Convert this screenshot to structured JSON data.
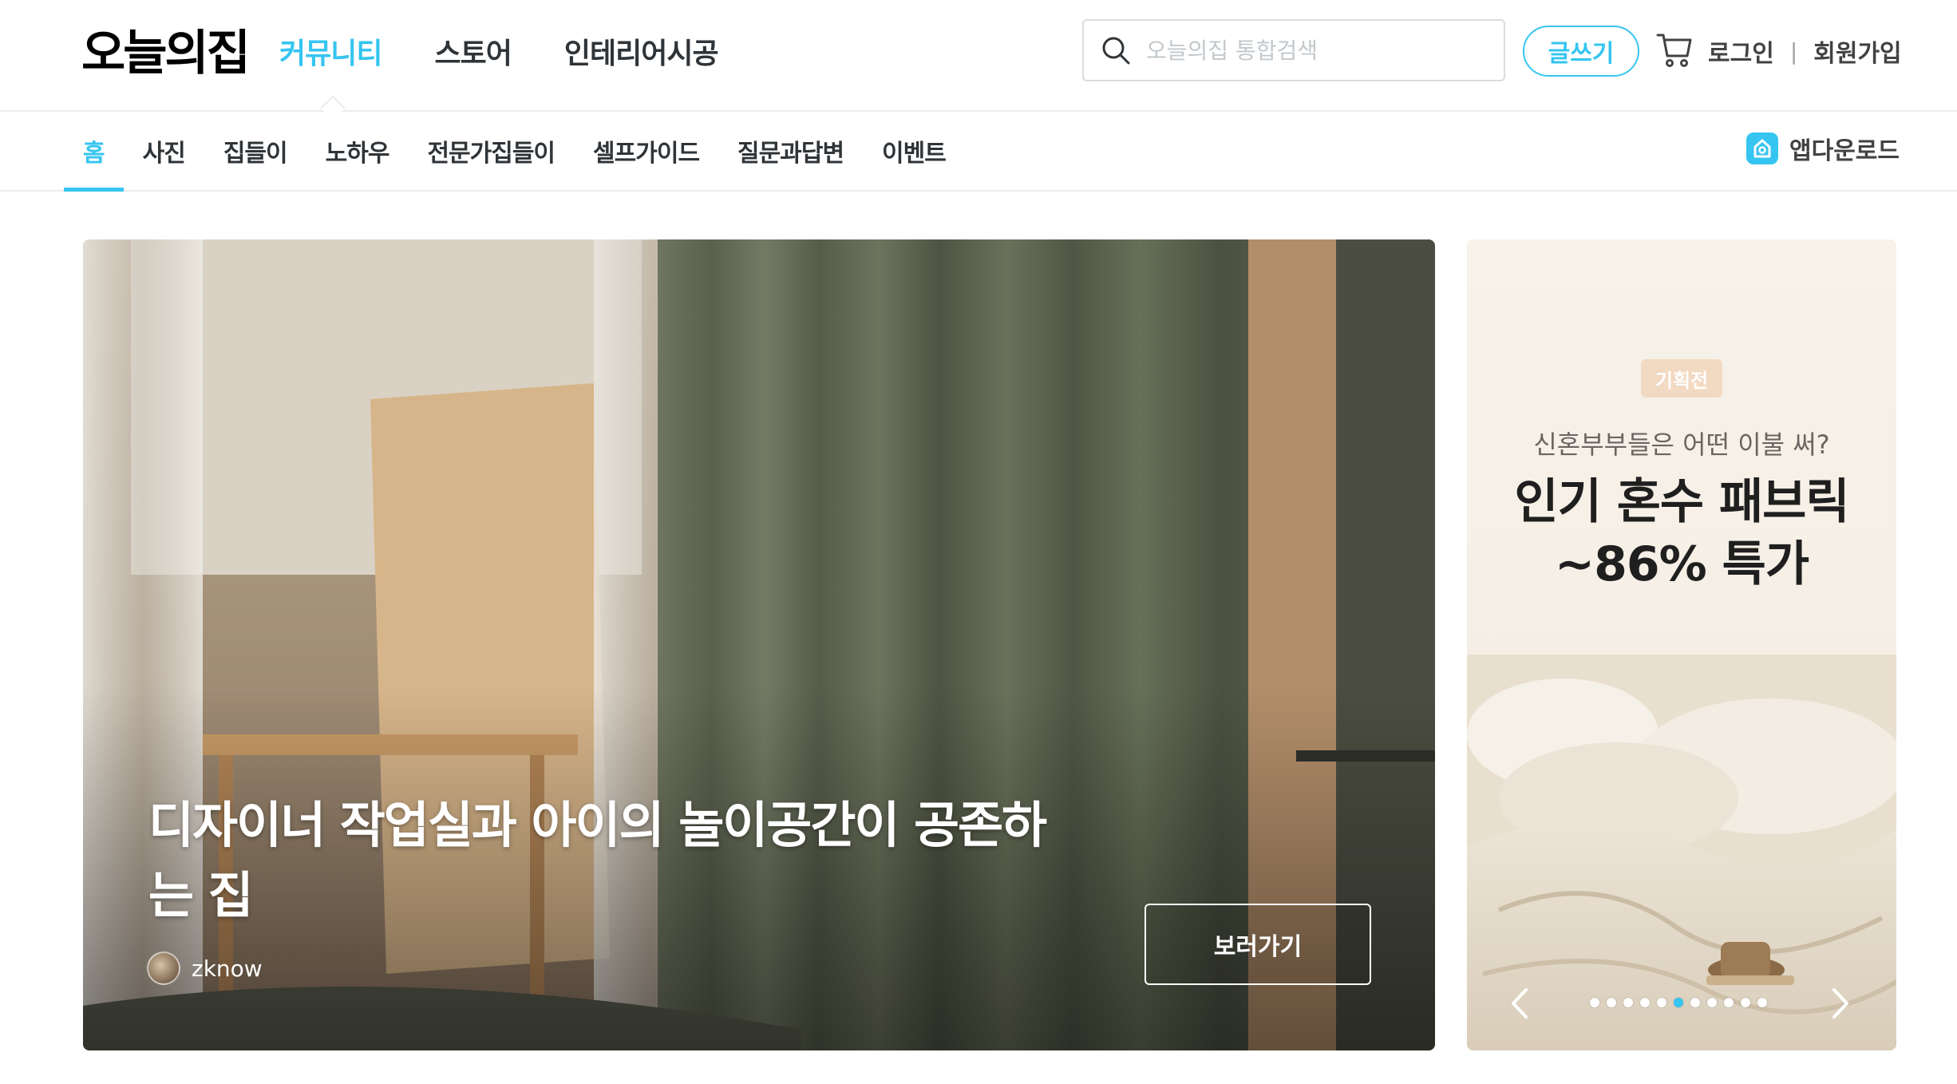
{
  "header": {
    "logo": "오늘의집",
    "gnb": [
      {
        "label": "커뮤니티",
        "active": true
      },
      {
        "label": "스토어",
        "active": false
      },
      {
        "label": "인테리어시공",
        "active": false
      }
    ],
    "search_placeholder": "오늘의집 통합검색",
    "write_label": "글쓰기",
    "login_label": "로그인",
    "separator": "|",
    "signup_label": "회원가입"
  },
  "subnav": {
    "items": [
      "홈",
      "사진",
      "집들이",
      "노하우",
      "전문가집들이",
      "셀프가이드",
      "질문과답변",
      "이벤트"
    ],
    "active_index": 0,
    "app_download_label": "앱다운로드"
  },
  "hero": {
    "title": "디자이너 작업실과 아이의 놀이공간이 공존하는 집",
    "author": "zknow",
    "cta_label": "보러가기"
  },
  "banner": {
    "badge": "기획전",
    "subtitle": "신혼부부들은 어떤 이불 써?",
    "title_line1": "인기 혼수 패브릭",
    "title_line2": "~86% 특가",
    "dot_count": 11,
    "active_dot": 5
  },
  "colors": {
    "accent": "#35c5f0",
    "text": "#2f3438",
    "border": "#ebeced"
  }
}
